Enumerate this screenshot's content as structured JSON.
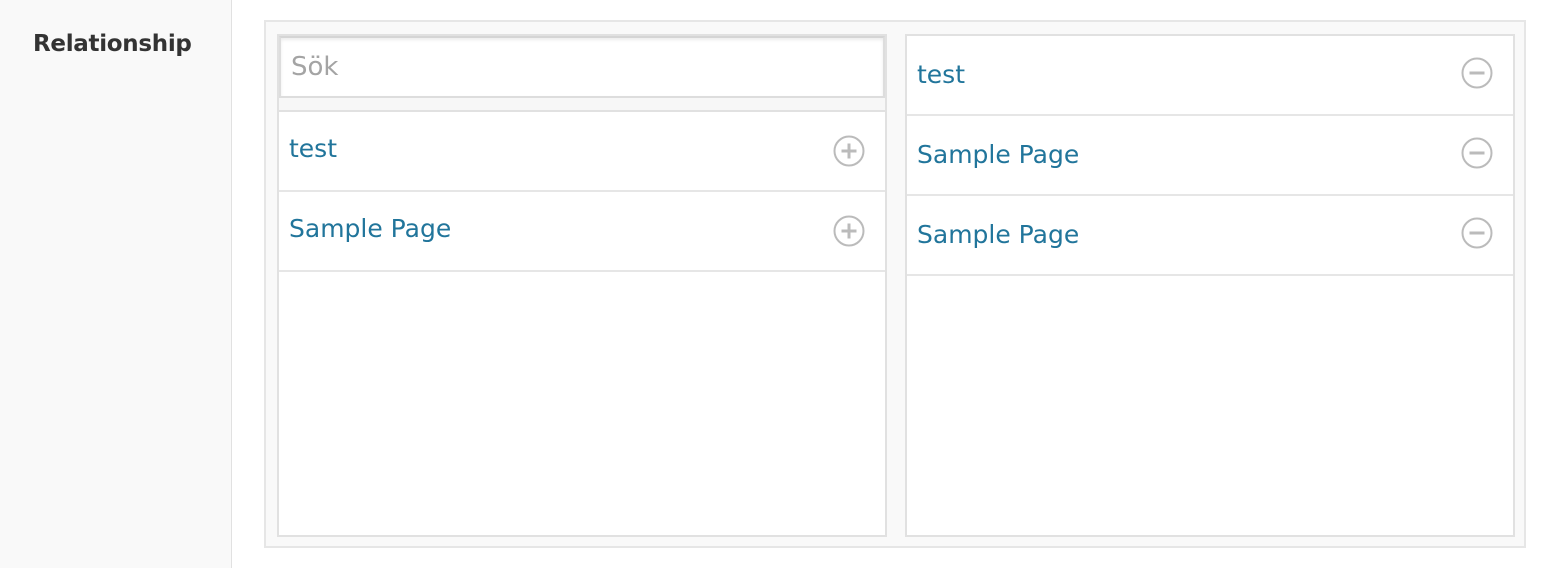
{
  "field": {
    "label": "Relationship"
  },
  "search": {
    "placeholder": "Sök",
    "value": ""
  },
  "choices": [
    {
      "label": "test",
      "icon": "plus-circle-icon"
    },
    {
      "label": "Sample Page",
      "icon": "plus-circle-icon"
    }
  ],
  "selected": [
    {
      "label": "test",
      "icon": "minus-circle-icon"
    },
    {
      "label": "Sample Page",
      "icon": "minus-circle-icon"
    },
    {
      "label": "Sample Page",
      "icon": "minus-circle-icon"
    }
  ],
  "colors": {
    "link": "#21759b",
    "icon": "#bbbbbb",
    "border": "#e1e1e1",
    "label_bg": "#f9f9f9"
  }
}
